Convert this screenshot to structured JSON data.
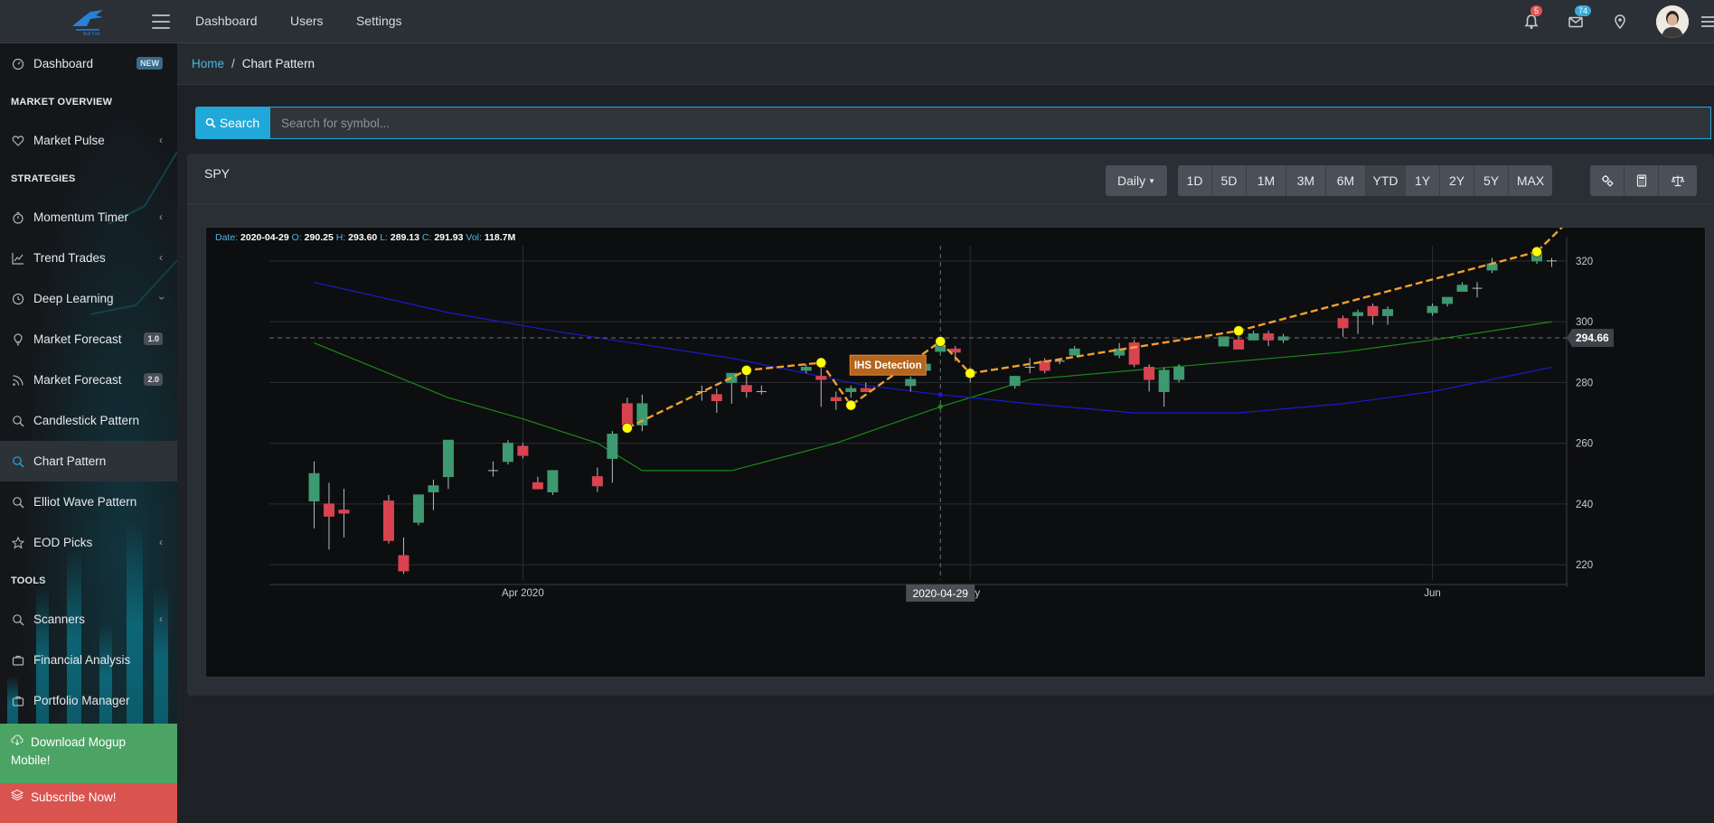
{
  "topnav": {
    "items": [
      "Dashboard",
      "Users",
      "Settings"
    ]
  },
  "topbar": {
    "notifications_count": "5",
    "messages_count": "74",
    "icons": [
      "bell-icon",
      "envelope-icon",
      "location-pin-icon",
      "avatar",
      "menu-icon"
    ]
  },
  "sidebar": {
    "dashboard": {
      "label": "Dashboard",
      "badge": "NEW"
    },
    "sections": {
      "market_overview": "MARKET OVERVIEW",
      "strategies": "STRATEGIES",
      "tools": "TOOLS"
    },
    "items": {
      "market_pulse": "Market Pulse",
      "momentum_timer": "Momentum Timer",
      "trend_trades": "Trend Trades",
      "deep_learning": "Deep Learning",
      "market_forecast_1": {
        "label": "Market Forecast",
        "badge": "1.0"
      },
      "market_forecast_2": {
        "label": "Market Forecast",
        "badge": "2.0"
      },
      "candlestick_pattern": "Candlestick Pattern",
      "chart_pattern": "Chart Pattern",
      "elliot_wave_pattern": "Elliot Wave Pattern",
      "eod_picks": "EOD Picks",
      "scanners": "Scanners",
      "financial_analysis": "Financial Analysis",
      "portfolio_manager": "Portfolio Manager"
    },
    "cta": {
      "download": "Download Mogup Mobile!",
      "subscribe": "Subscribe Now!"
    }
  },
  "breadcrumb": {
    "home": "Home",
    "separator": "/",
    "current": "Chart Pattern"
  },
  "search": {
    "button_label": "Search",
    "placeholder": "Search for symbol..."
  },
  "card": {
    "symbol": "SPY",
    "interval_label": "Daily",
    "ranges": [
      "1D",
      "5D",
      "1M",
      "3M",
      "6M",
      "YTD",
      "1Y",
      "2Y",
      "5Y",
      "MAX"
    ],
    "active_range": "YTD",
    "tool_icons": [
      "settings-icon",
      "calculator-icon",
      "balance-scale-icon"
    ]
  },
  "colors": {
    "accent": "#20a8d8",
    "up_candle": "#3d9970",
    "down_candle": "#d9434f",
    "pattern_line": "#f0a030",
    "pattern_point": "#ffff00",
    "ma_fast": "#1a8a1a",
    "ma_slow": "#1a1acc"
  },
  "chart_data": {
    "type": "candlestick",
    "symbol": "SPY",
    "ohlc_readout": {
      "date_label": "Date:",
      "date": "2020-04-29",
      "open_label": "O:",
      "open": "290.25",
      "high_label": "H:",
      "high": "293.60",
      "low_label": "L:",
      "low": "289.13",
      "close_label": "C:",
      "close": "291.93",
      "vol_label": "Vol:",
      "volume": "118.7M"
    },
    "last_price": "294.66",
    "crosshair_date": "2020-04-29",
    "annotation": "IHS Detection",
    "ylim": [
      215,
      325
    ],
    "yticks": [
      220,
      240,
      260,
      280,
      300,
      320
    ],
    "xticks": [
      {
        "label": "Apr 2020",
        "date": "2020-04-01"
      },
      {
        "label": "May",
        "date": "2020-05-01"
      },
      {
        "label": "Jun",
        "date": "2020-06-01"
      }
    ],
    "candles": [
      {
        "date": "2020-03-18",
        "o": 241,
        "h": 254,
        "l": 232,
        "c": 250
      },
      {
        "date": "2020-03-19",
        "o": 240,
        "h": 247,
        "l": 225,
        "c": 236
      },
      {
        "date": "2020-03-20",
        "o": 238,
        "h": 245,
        "l": 229,
        "c": 237
      },
      {
        "date": "2020-03-23",
        "o": 241,
        "h": 243,
        "l": 227,
        "c": 228
      },
      {
        "date": "2020-03-24",
        "o": 223,
        "h": 229,
        "l": 217,
        "c": 218
      },
      {
        "date": "2020-03-25",
        "o": 234,
        "h": 243,
        "l": 233,
        "c": 243
      },
      {
        "date": "2020-03-26",
        "o": 244,
        "h": 248,
        "l": 238,
        "c": 246
      },
      {
        "date": "2020-03-27",
        "o": 249,
        "h": 260,
        "l": 245,
        "c": 261
      },
      {
        "date": "2020-03-30",
        "o": 251,
        "h": 254,
        "l": 249,
        "c": 251
      },
      {
        "date": "2020-03-31",
        "o": 254,
        "h": 261,
        "l": 253,
        "c": 260
      },
      {
        "date": "2020-04-01",
        "o": 259,
        "h": 260,
        "l": 255,
        "c": 256
      },
      {
        "date": "2020-04-02",
        "o": 247,
        "h": 249,
        "l": 245,
        "c": 245
      },
      {
        "date": "2020-04-03",
        "o": 244,
        "h": 251,
        "l": 243,
        "c": 251
      },
      {
        "date": "2020-04-06",
        "o": 249,
        "h": 252,
        "l": 244,
        "c": 246
      },
      {
        "date": "2020-04-07",
        "o": 255,
        "h": 264,
        "l": 247,
        "c": 263
      },
      {
        "date": "2020-04-08",
        "o": 273,
        "h": 275,
        "l": 264,
        "c": 266
      },
      {
        "date": "2020-04-09",
        "o": 266,
        "h": 276,
        "l": 264,
        "c": 273
      },
      {
        "date": "2020-04-13",
        "o": 277,
        "h": 279,
        "l": 274,
        "c": 277
      },
      {
        "date": "2020-04-14",
        "o": 276,
        "h": 278,
        "l": 270,
        "c": 274
      },
      {
        "date": "2020-04-15",
        "o": 280,
        "h": 283,
        "l": 273,
        "c": 283
      },
      {
        "date": "2020-04-16",
        "o": 279,
        "h": 283,
        "l": 275,
        "c": 277
      },
      {
        "date": "2020-04-17",
        "o": 277,
        "h": 279,
        "l": 276,
        "c": 277
      },
      {
        "date": "2020-04-20",
        "o": 284,
        "h": 286,
        "l": 283,
        "c": 285
      },
      {
        "date": "2020-04-21",
        "o": 282,
        "h": 285,
        "l": 272,
        "c": 281
      },
      {
        "date": "2020-04-22",
        "o": 275,
        "h": 277,
        "l": 271,
        "c": 274
      },
      {
        "date": "2020-04-23",
        "o": 277,
        "h": 279,
        "l": 275,
        "c": 278
      },
      {
        "date": "2020-04-24",
        "o": 278,
        "h": 280,
        "l": 277,
        "c": 277
      },
      {
        "date": "2020-04-27",
        "o": 279,
        "h": 282,
        "l": 277,
        "c": 281
      },
      {
        "date": "2020-04-28",
        "o": 284,
        "h": 286,
        "l": 283,
        "c": 286
      },
      {
        "date": "2020-04-29",
        "o": 290.25,
        "h": 293.6,
        "l": 289.13,
        "c": 291.93
      },
      {
        "date": "2020-04-30",
        "o": 291,
        "h": 292,
        "l": 287,
        "c": 290
      },
      {
        "date": "2020-05-01",
        "o": 282,
        "h": 285,
        "l": 280,
        "c": 282
      },
      {
        "date": "2020-05-04",
        "o": 279,
        "h": 282,
        "l": 278,
        "c": 282
      },
      {
        "date": "2020-05-05",
        "o": 285,
        "h": 288,
        "l": 283,
        "c": 285
      },
      {
        "date": "2020-05-06",
        "o": 287,
        "h": 288,
        "l": 283,
        "c": 284
      },
      {
        "date": "2020-05-07",
        "o": 287,
        "h": 288,
        "l": 286,
        "c": 287
      },
      {
        "date": "2020-05-08",
        "o": 289,
        "h": 292,
        "l": 289,
        "c": 291
      },
      {
        "date": "2020-05-11",
        "o": 289,
        "h": 293,
        "l": 288,
        "c": 291
      },
      {
        "date": "2020-05-12",
        "o": 293,
        "h": 294,
        "l": 285,
        "c": 286
      },
      {
        "date": "2020-05-13",
        "o": 285,
        "h": 286,
        "l": 277,
        "c": 281
      },
      {
        "date": "2020-05-14",
        "o": 277,
        "h": 285,
        "l": 272,
        "c": 284
      },
      {
        "date": "2020-05-15",
        "o": 281,
        "h": 286,
        "l": 280,
        "c": 285
      },
      {
        "date": "2020-05-18",
        "o": 292,
        "h": 295,
        "l": 292,
        "c": 295
      },
      {
        "date": "2020-05-19",
        "o": 294,
        "h": 296,
        "l": 291,
        "c": 291
      },
      {
        "date": "2020-05-20",
        "o": 294,
        "h": 297,
        "l": 294,
        "c": 296
      },
      {
        "date": "2020-05-21",
        "o": 296,
        "h": 297,
        "l": 292,
        "c": 294
      },
      {
        "date": "2020-05-22",
        "o": 294,
        "h": 296,
        "l": 293,
        "c": 295
      },
      {
        "date": "2020-05-26",
        "o": 301,
        "h": 302,
        "l": 295,
        "c": 298
      },
      {
        "date": "2020-05-27",
        "o": 302,
        "h": 304,
        "l": 296,
        "c": 303
      },
      {
        "date": "2020-05-28",
        "o": 305,
        "h": 306,
        "l": 299,
        "c": 302
      },
      {
        "date": "2020-05-29",
        "o": 302,
        "h": 305,
        "l": 299,
        "c": 304
      },
      {
        "date": "2020-06-01",
        "o": 303,
        "h": 306,
        "l": 302,
        "c": 305
      },
      {
        "date": "2020-06-02",
        "o": 306,
        "h": 308,
        "l": 305,
        "c": 308
      },
      {
        "date": "2020-06-03",
        "o": 310,
        "h": 313,
        "l": 310,
        "c": 312
      },
      {
        "date": "2020-06-04",
        "o": 311,
        "h": 313,
        "l": 308,
        "c": 311
      },
      {
        "date": "2020-06-05",
        "o": 317,
        "h": 321,
        "l": 316,
        "c": 319
      },
      {
        "date": "2020-06-08",
        "o": 320,
        "h": 323,
        "l": 319,
        "c": 323
      },
      {
        "date": "2020-06-09",
        "o": 320,
        "h": 321,
        "l": 318,
        "c": 320
      }
    ],
    "series": [
      {
        "kind": "moving-average-fast",
        "points": [
          [
            "2020-03-18",
            293
          ],
          [
            "2020-03-27",
            275
          ],
          [
            "2020-04-01",
            268
          ],
          [
            "2020-04-06",
            260
          ],
          [
            "2020-04-09",
            251
          ],
          [
            "2020-04-15",
            251
          ],
          [
            "2020-04-22",
            260
          ],
          [
            "2020-04-29",
            272
          ],
          [
            "2020-05-05",
            281
          ],
          [
            "2020-05-12",
            284
          ],
          [
            "2020-05-19",
            287
          ],
          [
            "2020-05-26",
            290
          ],
          [
            "2020-06-01",
            294
          ],
          [
            "2020-06-09",
            300
          ]
        ]
      },
      {
        "kind": "moving-average-slow",
        "points": [
          [
            "2020-03-18",
            313
          ],
          [
            "2020-03-27",
            303
          ],
          [
            "2020-04-03",
            297
          ],
          [
            "2020-04-15",
            288
          ],
          [
            "2020-04-24",
            279
          ],
          [
            "2020-04-29",
            276
          ],
          [
            "2020-05-05",
            273
          ],
          [
            "2020-05-12",
            270
          ],
          [
            "2020-05-19",
            270
          ],
          [
            "2020-05-26",
            273
          ],
          [
            "2020-06-01",
            277
          ],
          [
            "2020-06-09",
            285
          ]
        ]
      }
    ],
    "pattern_points": [
      [
        "2020-04-08",
        265
      ],
      [
        "2020-04-16",
        284
      ],
      [
        "2020-04-21",
        286.5
      ],
      [
        "2020-04-23",
        272.5
      ],
      [
        "2020-04-29",
        293.5
      ],
      [
        "2020-05-01",
        283
      ],
      [
        "2020-05-19",
        297
      ],
      [
        "2020-06-08",
        323
      ]
    ]
  }
}
